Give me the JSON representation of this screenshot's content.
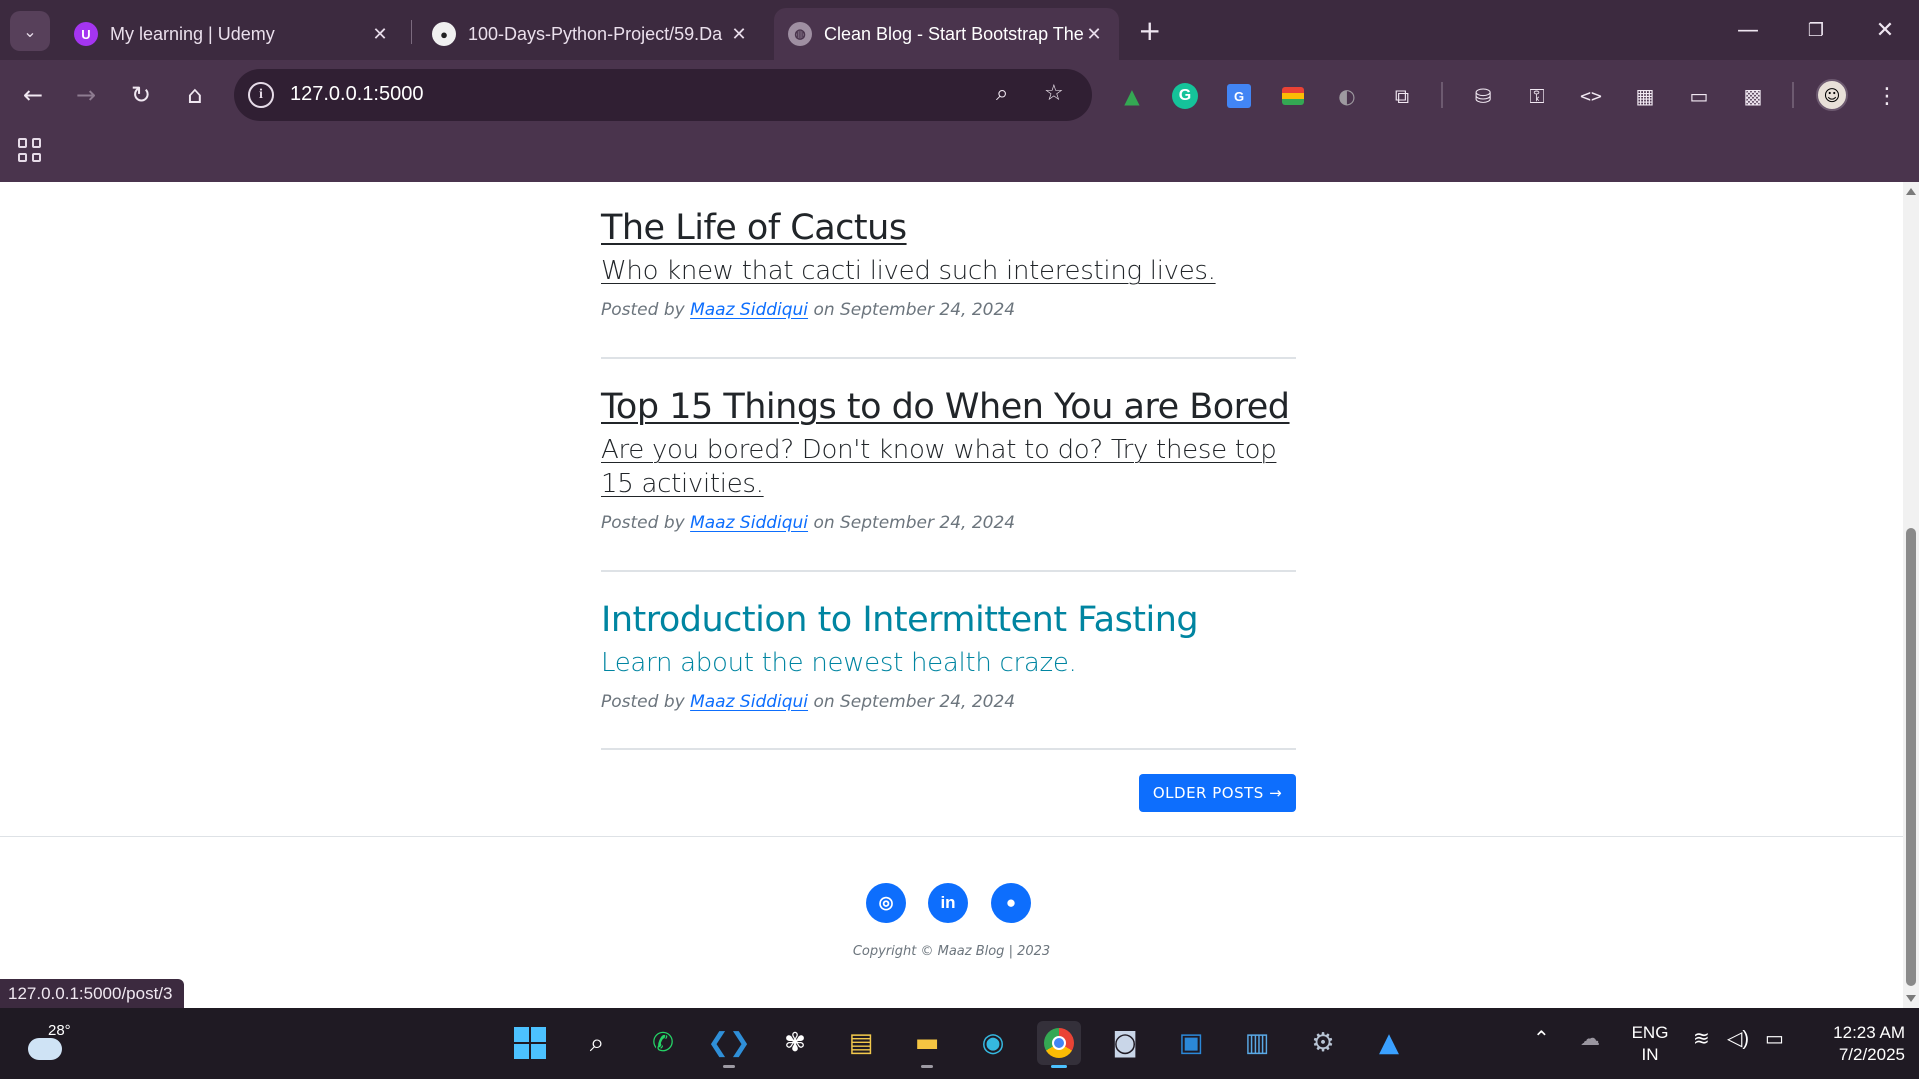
{
  "browser": {
    "tabs": [
      {
        "title": "My learning | Udemy",
        "favicon": "udemy-icon",
        "active": false
      },
      {
        "title": "100-Days-Python-Project/59.Da",
        "favicon": "github-icon",
        "active": false
      },
      {
        "title": "Clean Blog - Start Bootstrap The",
        "favicon": "globe-icon",
        "active": true
      }
    ],
    "url": "127.0.0.1:5000",
    "status_url": "127.0.0.1:5000/post/3"
  },
  "blog": {
    "posts": [
      {
        "title": "The Life of Cactus",
        "subtitle": "Who knew that cacti lived such interesting lives.",
        "meta_prefix": "Posted by",
        "author": "Maaz Siddiqui",
        "meta_suffix": "on September 24, 2024"
      },
      {
        "title": "Top 15 Things to do When You are Bored",
        "subtitle": "Are you bored? Don't know what to do? Try these top 15 activities.",
        "meta_prefix": "Posted by",
        "author": "Maaz Siddiqui",
        "meta_suffix": "on September 24, 2024"
      },
      {
        "title": "Introduction to Intermittent Fasting",
        "subtitle": "Learn about the newest health craze.",
        "meta_prefix": "Posted by",
        "author": "Maaz Siddiqui",
        "meta_suffix": "on September 24, 2024"
      }
    ],
    "older_posts_label": "OLDER POSTS →",
    "footer": {
      "social": [
        "instagram-icon",
        "linkedin-icon",
        "github-icon"
      ],
      "copyright": "Copyright © Maaz Blog | 2023"
    }
  },
  "taskbar": {
    "temperature": "28°",
    "language_line1": "ENG",
    "language_line2": "IN",
    "time": "12:23 AM",
    "date": "7/2/2025"
  },
  "colors": {
    "chrome_dark": "#3c2a3f",
    "chrome_toolbar": "#4a344d",
    "link_blue": "#0d6efd",
    "hover_teal": "#0085a1",
    "text_dark": "#212529",
    "meta_gray": "#6c757d"
  }
}
